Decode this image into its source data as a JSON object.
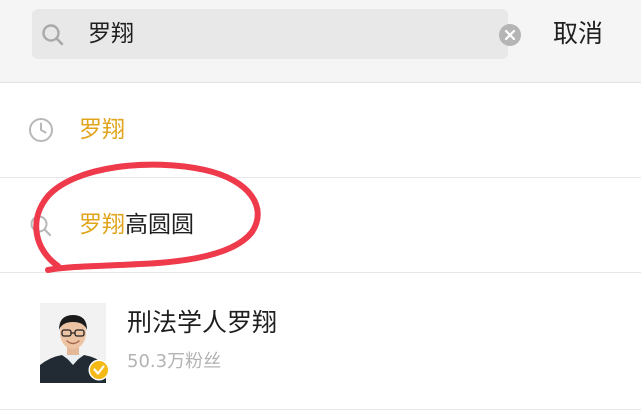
{
  "search": {
    "query": "罗翔",
    "cancel_label": "取消"
  },
  "history": {
    "item": "罗翔",
    "icon": "clock-icon"
  },
  "suggestion": {
    "highlight": "罗翔",
    "rest": "高圆圆",
    "icon": "search-icon"
  },
  "account": {
    "name": "刑法学人罗翔",
    "followers": "50.3万粉丝",
    "badge": "verified-badge-icon"
  },
  "colors": {
    "highlight": "#e0a51c",
    "annotation": "#ee3a4a",
    "badge": "#f5b915"
  }
}
